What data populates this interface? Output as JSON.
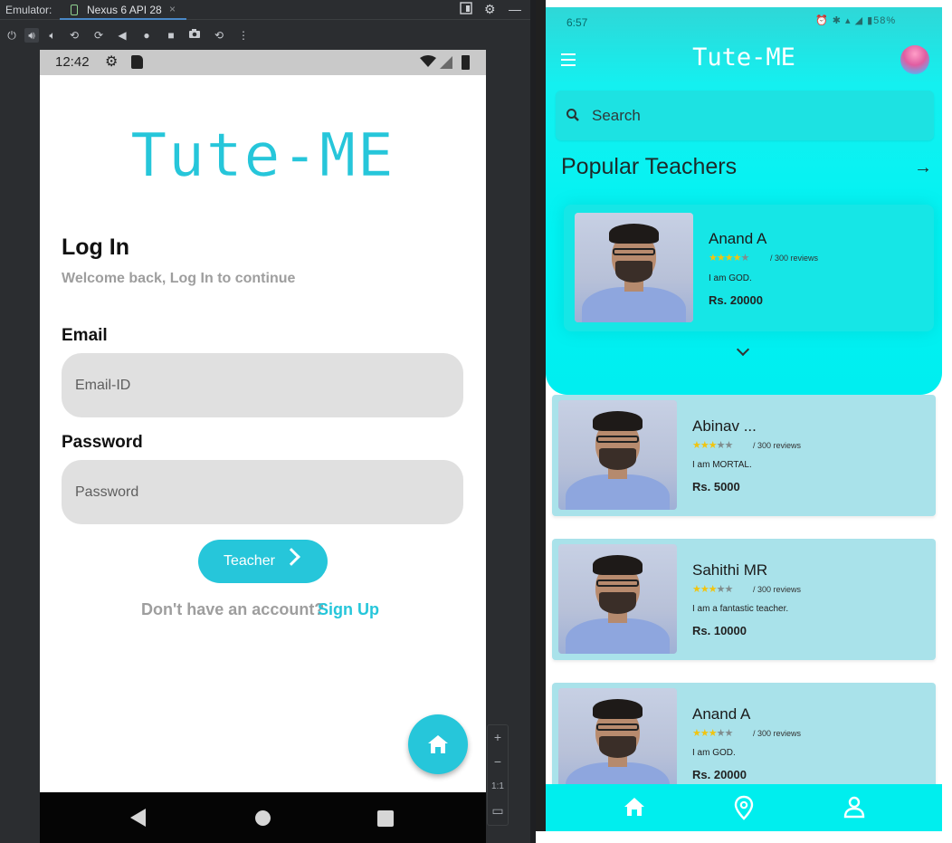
{
  "emulator": {
    "label": "Emulator:",
    "tab_title": "Nexus 6 API 28",
    "tab_close": "×",
    "zoom_label": "1:1",
    "zoom_plus": "+",
    "zoom_minus": "−"
  },
  "login_screen": {
    "status_time": "12:42",
    "logo": "Tute-ME",
    "title": "Log In",
    "subtitle": "Welcome back, Log In to continue",
    "email_label": "Email",
    "email_placeholder": "Email-ID",
    "password_label": "Password",
    "password_placeholder": "Password",
    "teacher_button": "Teacher",
    "no_account_text": "Don't have an account?",
    "signup_link": "Sign Up"
  },
  "home_screen": {
    "status_time": "6:57",
    "status_battery": "58%",
    "logo": "Tute-ME",
    "search_placeholder": "Search",
    "section_title": "Popular Teachers",
    "featured": {
      "name": "Anand A",
      "rating": 3.5,
      "reviews": "/ 300 reviews",
      "description": "I am GOD.",
      "price": "Rs. 20000"
    },
    "teachers": [
      {
        "name": "Abinav ...",
        "rating": 3.5,
        "reviews": "/ 300 reviews",
        "description": "I am MORTAL.",
        "price": "Rs. 5000"
      },
      {
        "name": "Sahithi MR",
        "rating": 3.5,
        "reviews": "/ 300 reviews",
        "description": "I am a fantastic teacher.",
        "price": "Rs. 10000"
      },
      {
        "name": "Anand A",
        "rating": 3.5,
        "reviews": "/ 300 reviews",
        "description": "I am GOD.",
        "price": "Rs. 20000"
      }
    ],
    "bottom_nav": [
      "home-icon",
      "location-pin-icon",
      "profile-icon"
    ]
  },
  "colors": {
    "accent": "#26c6da",
    "header_cyan": "#00f3f3",
    "card_bg": "#a9e2ea",
    "star": "#f1c40f"
  }
}
